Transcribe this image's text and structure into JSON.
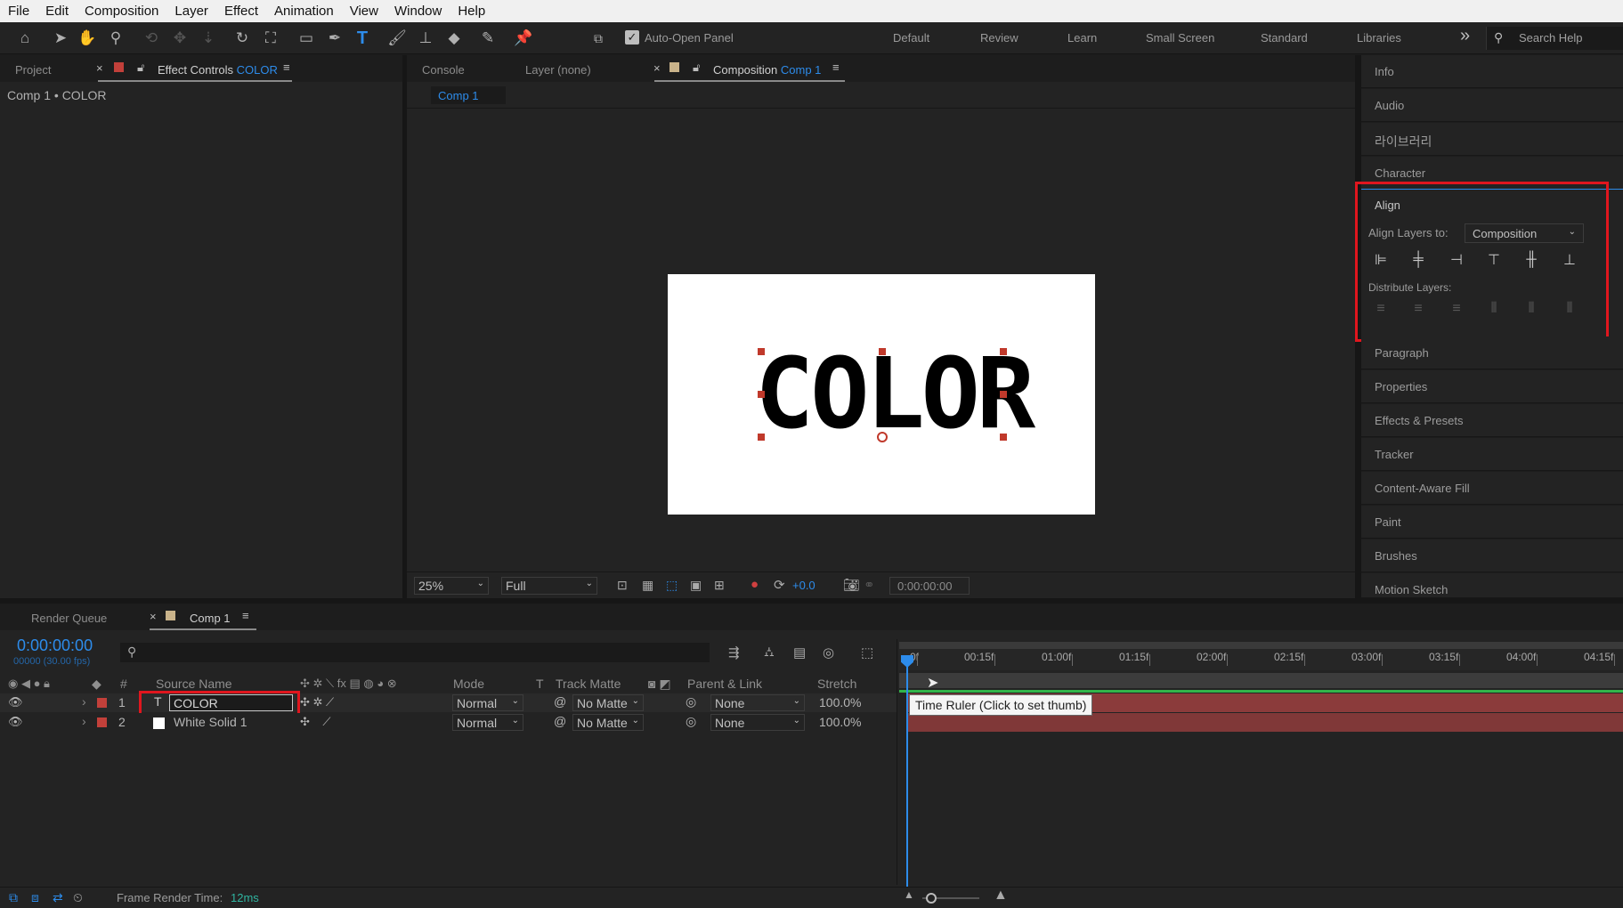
{
  "menu": [
    "File",
    "Edit",
    "Composition",
    "Layer",
    "Effect",
    "Animation",
    "View",
    "Window",
    "Help"
  ],
  "toolbar": {
    "auto_open_label": "Auto-Open Panel",
    "auto_open_checked": true,
    "workspaces": [
      "Default",
      "Review",
      "Learn",
      "Small Screen",
      "Standard",
      "Libraries"
    ],
    "overflow": "»",
    "search_placeholder": "Search Help"
  },
  "left_panel": {
    "tab_project": "Project",
    "tab_effect_prefix": "Effect Controls",
    "tab_effect_layer": "COLOR",
    "breadcrumb": "Comp 1 • COLOR"
  },
  "center_panel": {
    "tab_console": "Console",
    "tab_layer": "Layer (none)",
    "tab_comp_prefix": "Composition",
    "tab_comp_name": "Comp 1",
    "sub_tab": "Comp 1",
    "canvas_text": "COLOR",
    "zoom": "25%",
    "resolution": "Full",
    "exposure": "+0.0",
    "timecode": "0:00:00:00"
  },
  "right_panel": {
    "items_top": [
      "Info",
      "Audio",
      "라이브러리",
      "Character"
    ],
    "align": {
      "title": "Align",
      "align_to_label": "Align Layers to:",
      "align_to_value": "Composition",
      "distribute_label": "Distribute Layers:"
    },
    "items_bottom": [
      "Paragraph",
      "Properties",
      "Effects & Presets",
      "Tracker",
      "Content-Aware Fill",
      "Paint",
      "Brushes",
      "Motion Sketch"
    ]
  },
  "timeline": {
    "tab_render": "Render Queue",
    "tab_comp": "Comp 1",
    "current_time": "0:00:00:00",
    "frame_info": "00000 (30.00 fps)",
    "headers": {
      "num": "#",
      "source": "Source Name",
      "mode": "Mode",
      "t": "T",
      "track_matte": "Track Matte",
      "parent": "Parent & Link",
      "stretch": "Stretch"
    },
    "layers": [
      {
        "num": "1",
        "name": "COLOR",
        "type_icon": "T",
        "mode": "Normal",
        "matte": "No Matte",
        "parent": "None",
        "stretch": "100.0%"
      },
      {
        "num": "2",
        "name": "White Solid 1",
        "mode": "Normal",
        "matte": "No Matte",
        "parent": "None",
        "stretch": "100.0%"
      }
    ],
    "ruler_ticks": [
      "0f",
      "00:15f",
      "01:00f",
      "01:15f",
      "02:00f",
      "02:15f",
      "03:00f",
      "03:15f",
      "04:00f",
      "04:15f"
    ],
    "tooltip": "Time Ruler (Click to set thumb)",
    "frame_render_label": "Frame Render Time:",
    "frame_render_value": "12ms"
  },
  "colors": {
    "accent_blue": "#2d8ceb",
    "highlight_red": "#e0161e",
    "label_red": "#c2403a",
    "work_green": "#32b44a",
    "bar_red": "#8b3b3b"
  }
}
